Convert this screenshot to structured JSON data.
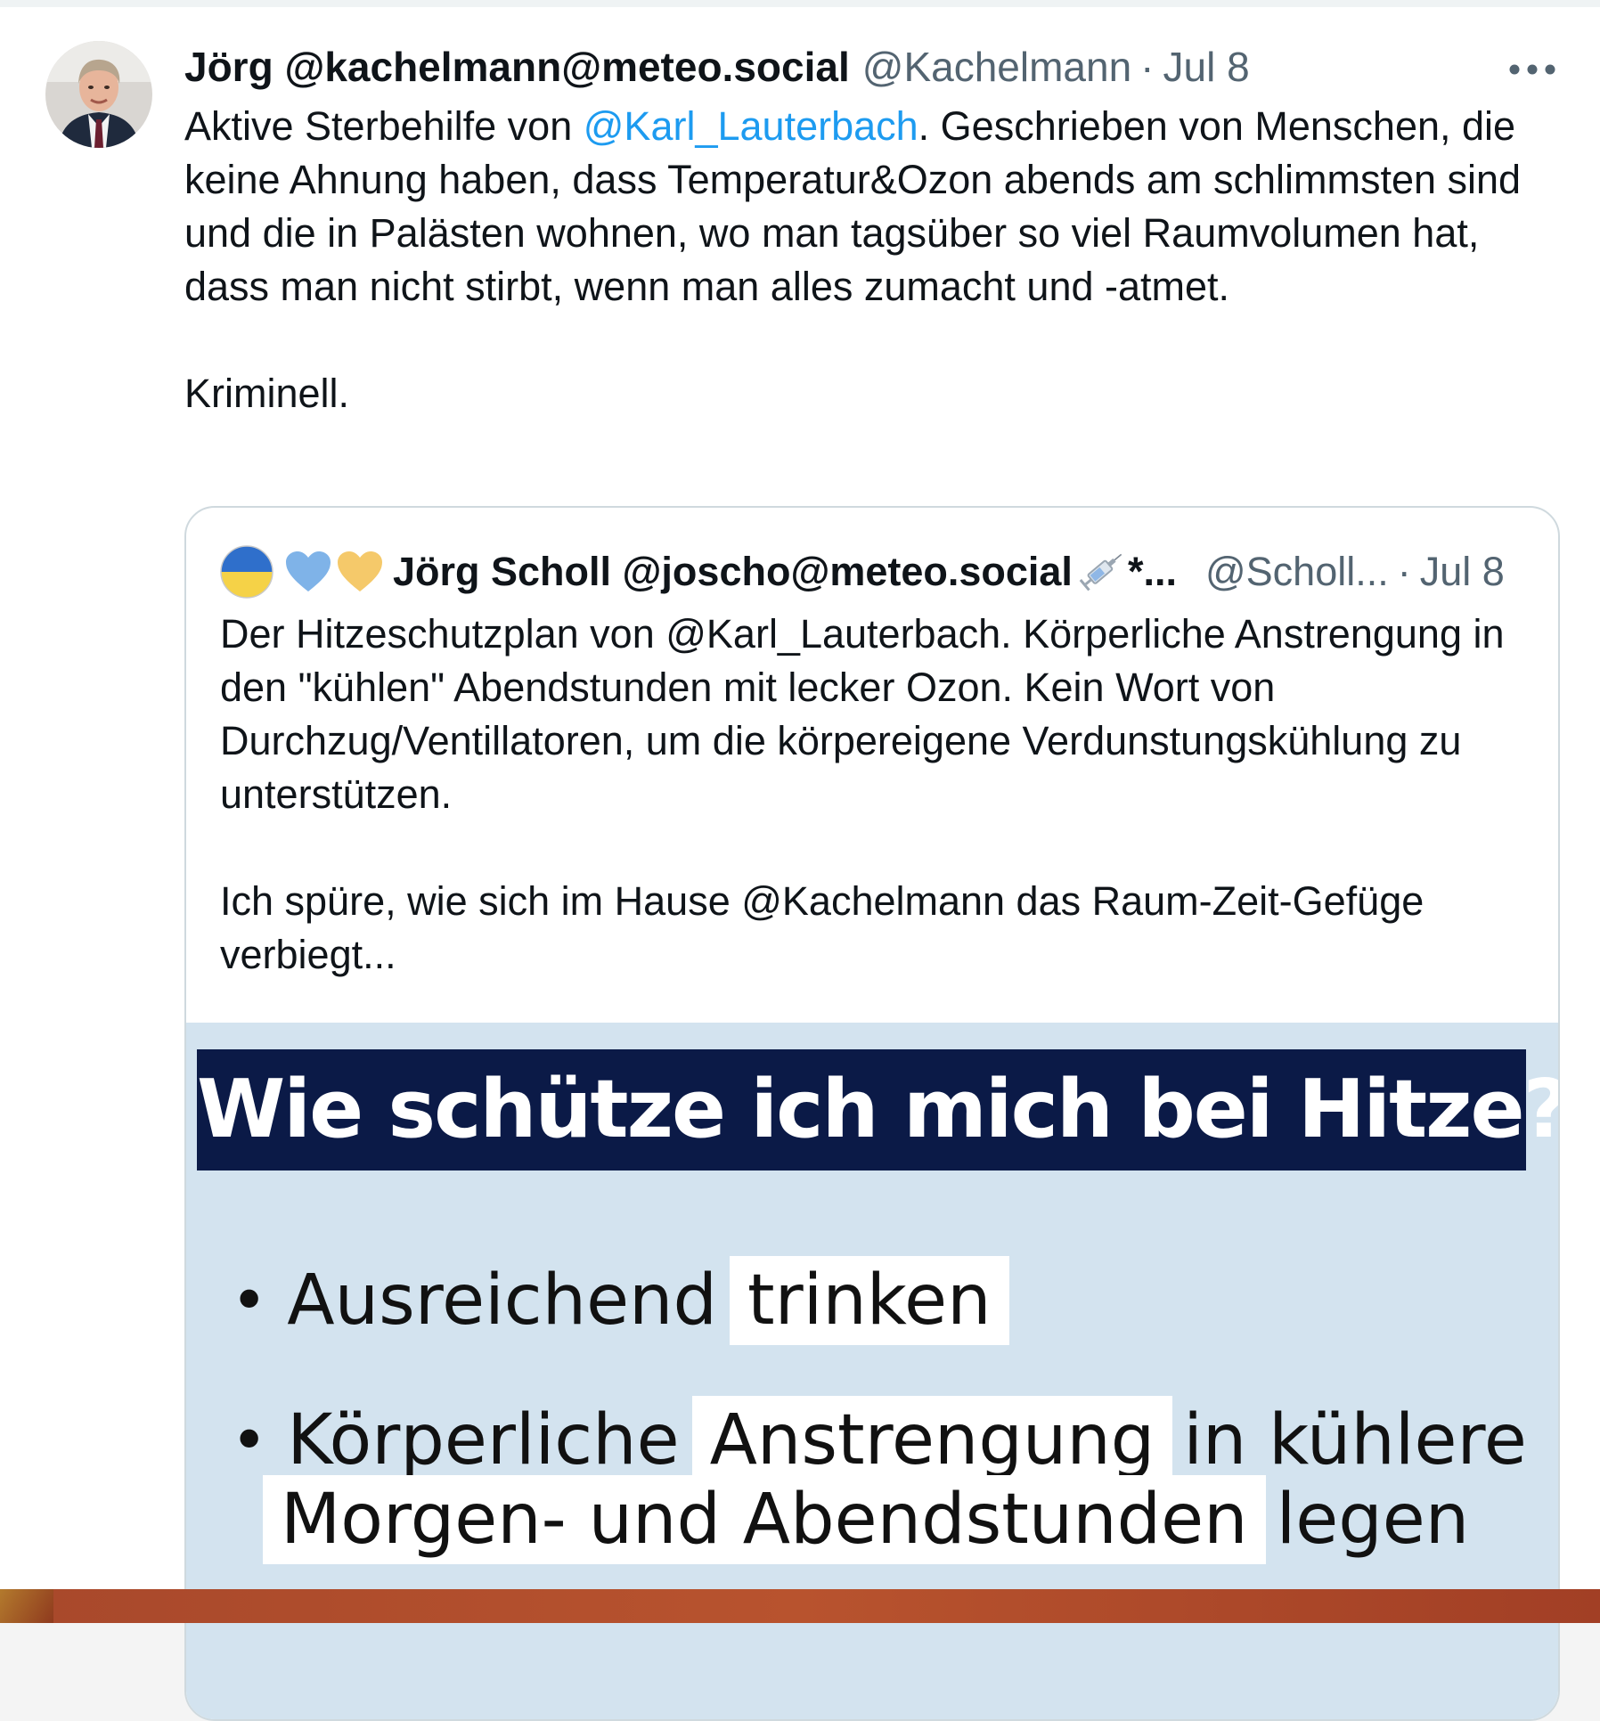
{
  "tweet": {
    "author_name": "Jörg @kachelmann@meteo.social",
    "handle": "@Kachelmann",
    "separator": "·",
    "date": "Jul 8",
    "text_before_mention": "Aktive Sterbehilfe von ",
    "mention": "@Karl_Lauterbach",
    "text_after_mention": ". Geschrieben von Menschen, die keine Ahnung haben, dass Temperatur&Ozon abends am schlimmsten sind und die in Palästen wohnen, wo man tagsüber so viel Raumvolumen hat, dass man nicht stirbt, wenn man alles zumacht und -atmet.\n\nKriminell.",
    "more_icon": "more-horizontal-icon"
  },
  "quote": {
    "author_name": "Jörg Scholl @joscho@meteo.social",
    "name_overflow": "*...",
    "handle": "@Scholl...",
    "separator": "·",
    "date": "Jul 8",
    "text": "Der Hitzeschutzplan von @Karl_Lauterbach. Körperliche Anstrengung in den \"kühlen\" Abendstunden mit lecker Ozon. Kein Wort von Durchzug/Ventillatoren, um die körpereigene Verdunstungskühlung zu unterstützen.\n\nIch spüre, wie sich im Hause @Kachelmann das Raum-Zeit-Gefüge verbiegt...",
    "icons": [
      "ukraine-flag-icon",
      "blue-heart-icon",
      "yellow-heart-icon",
      "syringe-icon"
    ],
    "media": {
      "heading": "Wie schütze ich mich bei Hitze?",
      "bullet_symbol": "•",
      "line1_plain": "Ausreichend",
      "line1_highlight": "trinken",
      "line2_plain": "Körperliche",
      "line2_highlight": "Anstrengung",
      "line2_tail": "in kühlere",
      "line3_highlight": "Morgen- und Abendstunden",
      "line3_tail": "legen"
    }
  },
  "colors": {
    "text": "#0f1419",
    "secondary": "#536471",
    "mention": "#1d9bf0",
    "border": "#cfd9de",
    "media_background": "#d3e3ef",
    "media_heading_background": "#0b1a47",
    "blue_heart": "#7fb3e8",
    "yellow_heart": "#f5c96a"
  }
}
